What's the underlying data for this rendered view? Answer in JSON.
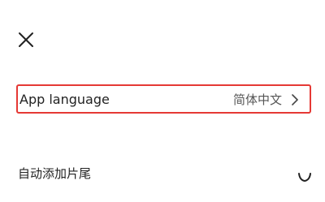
{
  "icons": {
    "close": "close-icon",
    "chevron": "chevron-right-icon"
  },
  "settings": {
    "app_language": {
      "label": "App language",
      "value": "简体中文"
    },
    "auto_add_ending": {
      "label": "自动添加片尾"
    }
  },
  "colors": {
    "highlight_border": "#e53935",
    "text_primary": "#222222",
    "text_secondary": "#555555"
  }
}
